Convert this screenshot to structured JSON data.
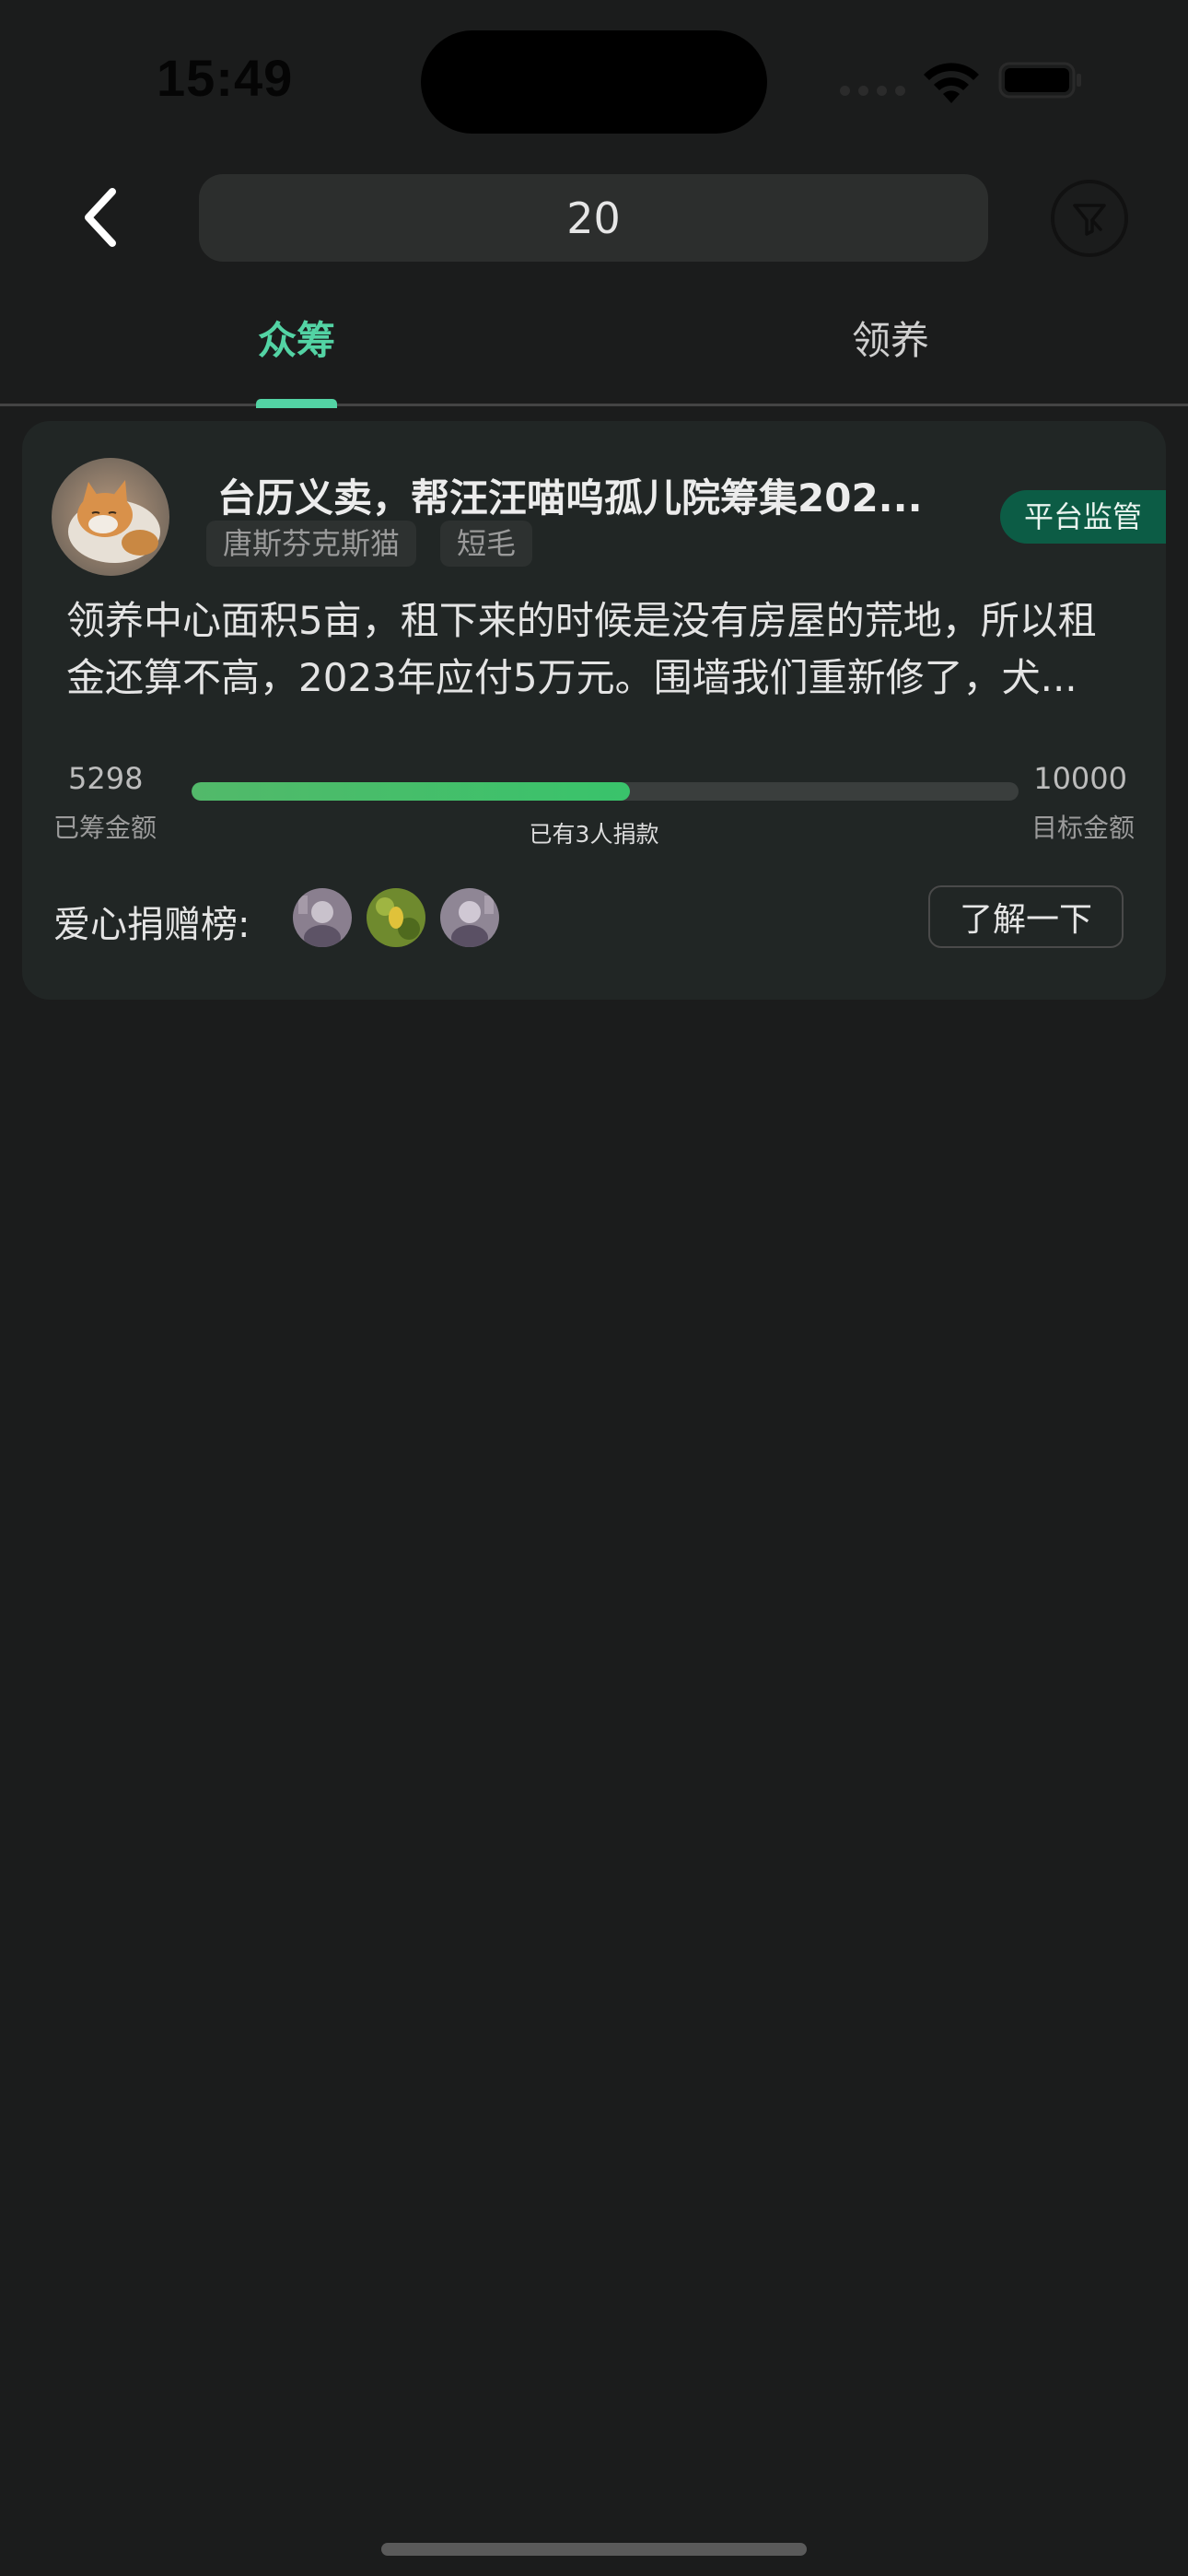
{
  "status_bar": {
    "time": "15:49"
  },
  "header": {
    "search": {
      "value": "20"
    },
    "back_icon": "chevron-left-icon",
    "filter_icon": "funnel-icon"
  },
  "tabs": [
    {
      "label": "众筹",
      "active": true
    },
    {
      "label": "领养",
      "active": false
    }
  ],
  "card": {
    "title": "台历义卖，帮汪汪喵呜孤儿院筹集202...",
    "tags": [
      "唐斯芬克斯猫",
      "短毛"
    ],
    "badge": "平台监管",
    "description": "领养中心面积5亩，租下来的时候是没有房屋的荒地，所以租金还算不高，2023年应付5万元。围墙我们重新修了，犬...",
    "raised": {
      "amount": "5298",
      "label": "已筹金额"
    },
    "target": {
      "amount": "10000",
      "label": "目标金额"
    },
    "progress_fraction": 0.5298,
    "donors_text": "已有3人捐款",
    "leaderboard_label": "爱心捐赠榜:",
    "learn_more_label": "了解一下"
  },
  "colors": {
    "accent": "#53d3a4",
    "background": "#1b1c1c",
    "card": "#212625",
    "badge": "#0c5c45",
    "progress": "#39c36b"
  }
}
